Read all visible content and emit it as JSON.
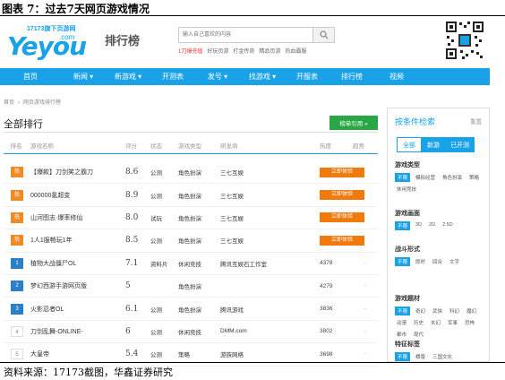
{
  "figure": {
    "title": "图表 7：过去7天网页游戏情况",
    "source": "资料来源：17173截图，华鑫证券研究"
  },
  "header": {
    "logo_sub": "17173旗下页游网",
    "logo_main": "Yeyou",
    "logo_com": ".com",
    "heading": "排行榜",
    "search_placeholder": "输入自己喜欢的内容",
    "hot_links": [
      "1刀爆充值",
      "好玩页游",
      "打金传奇",
      "精品页游",
      "热血霸服"
    ]
  },
  "nav": [
    "首页",
    "新闻 ▾",
    "新游戏 ▾",
    "开测表",
    "发号 ▾",
    "找游戏 ▾",
    "开服表",
    "排行榜",
    "视频"
  ],
  "breadcrumb": [
    "首页",
    "网页游戏排行榜"
  ],
  "section": {
    "title": "全部排行",
    "cite_button": "榜单引用 »"
  },
  "table": {
    "headers": [
      "排名",
      "游戏名称",
      "评分",
      "状态",
      "游戏类型",
      "研发商",
      "热度",
      "趋势"
    ],
    "rows": [
      {
        "rank": "热",
        "name": "【爆款】刀剑笑之霸刀",
        "score": "8.6",
        "status": "公测",
        "type": "角色扮演",
        "dev": "三七互娱",
        "heat": "立即体验",
        "trend": "",
        "style": "hot",
        "btn": true
      },
      {
        "rank": "热",
        "name": "000000氪超变",
        "score": "8.9",
        "status": "公测",
        "type": "角色扮演",
        "dev": "三七互娱",
        "heat": "立即体验",
        "trend": "",
        "style": "hot",
        "btn": true
      },
      {
        "rank": "热",
        "name": "山河图志·爆率修仙",
        "score": "8.0",
        "status": "试玩",
        "type": "角色扮演",
        "dev": "三七互娱",
        "heat": "立即体验",
        "trend": "",
        "style": "hot",
        "btn": true
      },
      {
        "rank": "热",
        "name": "1人1服畅玩1年",
        "score": "8.5",
        "status": "公测",
        "type": "角色扮演",
        "dev": "三七互娱",
        "heat": "立即体验",
        "trend": "",
        "style": "hot",
        "btn": true
      },
      {
        "rank": "1",
        "name": "植物大战僵尸OL",
        "score": "7.1",
        "status": "资料片",
        "type": "休闲竞技",
        "dev": "腾讯互娱石工作室",
        "heat": "4378",
        "trend": "-",
        "style": "blue",
        "btn": false
      },
      {
        "rank": "2",
        "name": "梦幻西游手游网页版",
        "score": "5",
        "status": "",
        "type": "角色扮演",
        "dev": "",
        "heat": "4279",
        "trend": "-",
        "style": "blue",
        "btn": false
      },
      {
        "rank": "3",
        "name": "火影忍者OL",
        "score": "6.1",
        "status": "公测",
        "type": "角色扮演",
        "dev": "腾讯游戏",
        "heat": "3836",
        "trend": "-",
        "style": "blue",
        "btn": false
      },
      {
        "rank": "4",
        "name": "刀剑乱舞-ONLINE-",
        "score": "6",
        "status": "公测",
        "type": "休闲竞技",
        "dev": "DMM.com",
        "heat": "3802",
        "trend": "-",
        "style": "gray",
        "btn": false
      },
      {
        "rank": "5",
        "name": "大皇帝",
        "score": "5.4",
        "status": "公测",
        "type": "策略",
        "dev": "游族网络",
        "heat": "3698",
        "trend": "-",
        "style": "gray",
        "btn": false
      }
    ]
  },
  "filter": {
    "title": "按条件检索",
    "reset": "重置",
    "tabs": [
      "全部",
      "新游",
      "已开测"
    ],
    "groups": [
      {
        "title": "游戏类型",
        "options": [
          "不限",
          "模拟经营",
          "角色扮演",
          "策略",
          "休闲竞技"
        ]
      },
      {
        "title": "游戏画面",
        "options": [
          "不限",
          "3D",
          "2D",
          "2.5D"
        ]
      },
      {
        "title": "战斗形式",
        "options": [
          "不限",
          "即时",
          "回合",
          "文字"
        ]
      },
      {
        "title": "游戏题材",
        "options": [
          "不限",
          "奇幻",
          "武侠",
          "科幻",
          "魔幻",
          "动漫",
          "历史",
          "玄幻",
          "军事",
          "恐怖",
          "都市",
          "现代"
        ]
      },
      {
        "title": "特征标签",
        "options": [
          "不限",
          "横版",
          "三国文化"
        ]
      }
    ]
  }
}
